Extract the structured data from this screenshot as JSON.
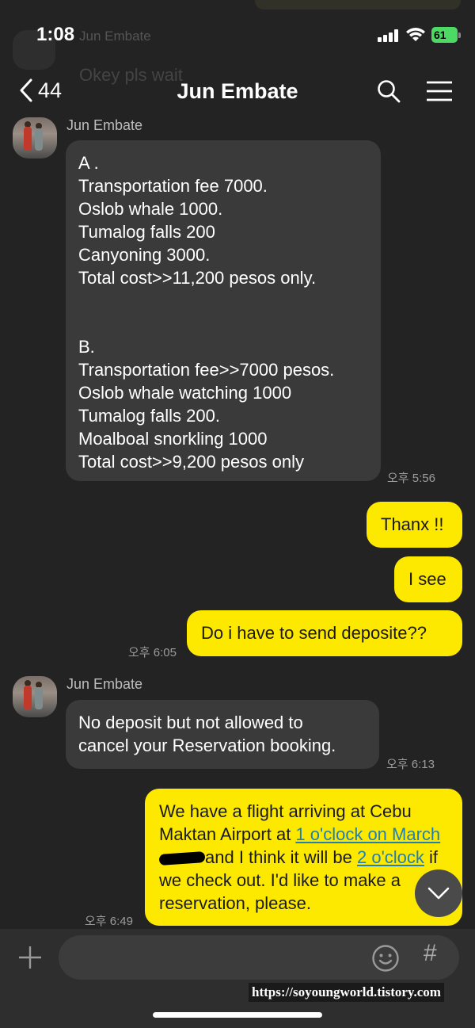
{
  "status_bar": {
    "time": "1:08",
    "battery": "61"
  },
  "background_ghost": {
    "name": "Jun Embate",
    "message": "Okey pls wait"
  },
  "header": {
    "back_count": "44",
    "title": "Jun Embate"
  },
  "messages": [
    {
      "type": "in",
      "sender": "Jun Embate",
      "text": "A .\nTransportation fee 7000.\nOslob whale 1000.\nTumalog falls 200\nCanyoning 3000.\nTotal cost>>11,200 pesos only.\n\n\nB.\nTransportation fee>>7000 pesos.\nOslob whale watching 1000\nTumalog falls 200.\nMoalboal snorkling 1000\nTotal cost>>9,200 pesos only",
      "time": "오후 5:56"
    },
    {
      "type": "out",
      "text": "Thanx !!"
    },
    {
      "type": "out",
      "text": "I see"
    },
    {
      "type": "out",
      "text": "Do i have to send deposite??",
      "time": "오후 6:05"
    },
    {
      "type": "in",
      "sender": "Jun Embate",
      "text": "No deposit but not allowed to\ncancel your Reservation booking.",
      "time": "오후 6:13"
    },
    {
      "type": "out",
      "time": "오후 6:49",
      "parts": {
        "p1": "We have a flight arriving at Cebu Maktan Airport at ",
        "link1": "1 o'clock on March",
        "p2": "and I think it will be ",
        "link2": "2 o'clock",
        "p3": " if we check out. I'd like to make a reservation, please."
      }
    }
  ],
  "composer": {
    "placeholder": "",
    "hash": "#"
  },
  "watermark": "https://soyoungworld.tistory.com"
}
